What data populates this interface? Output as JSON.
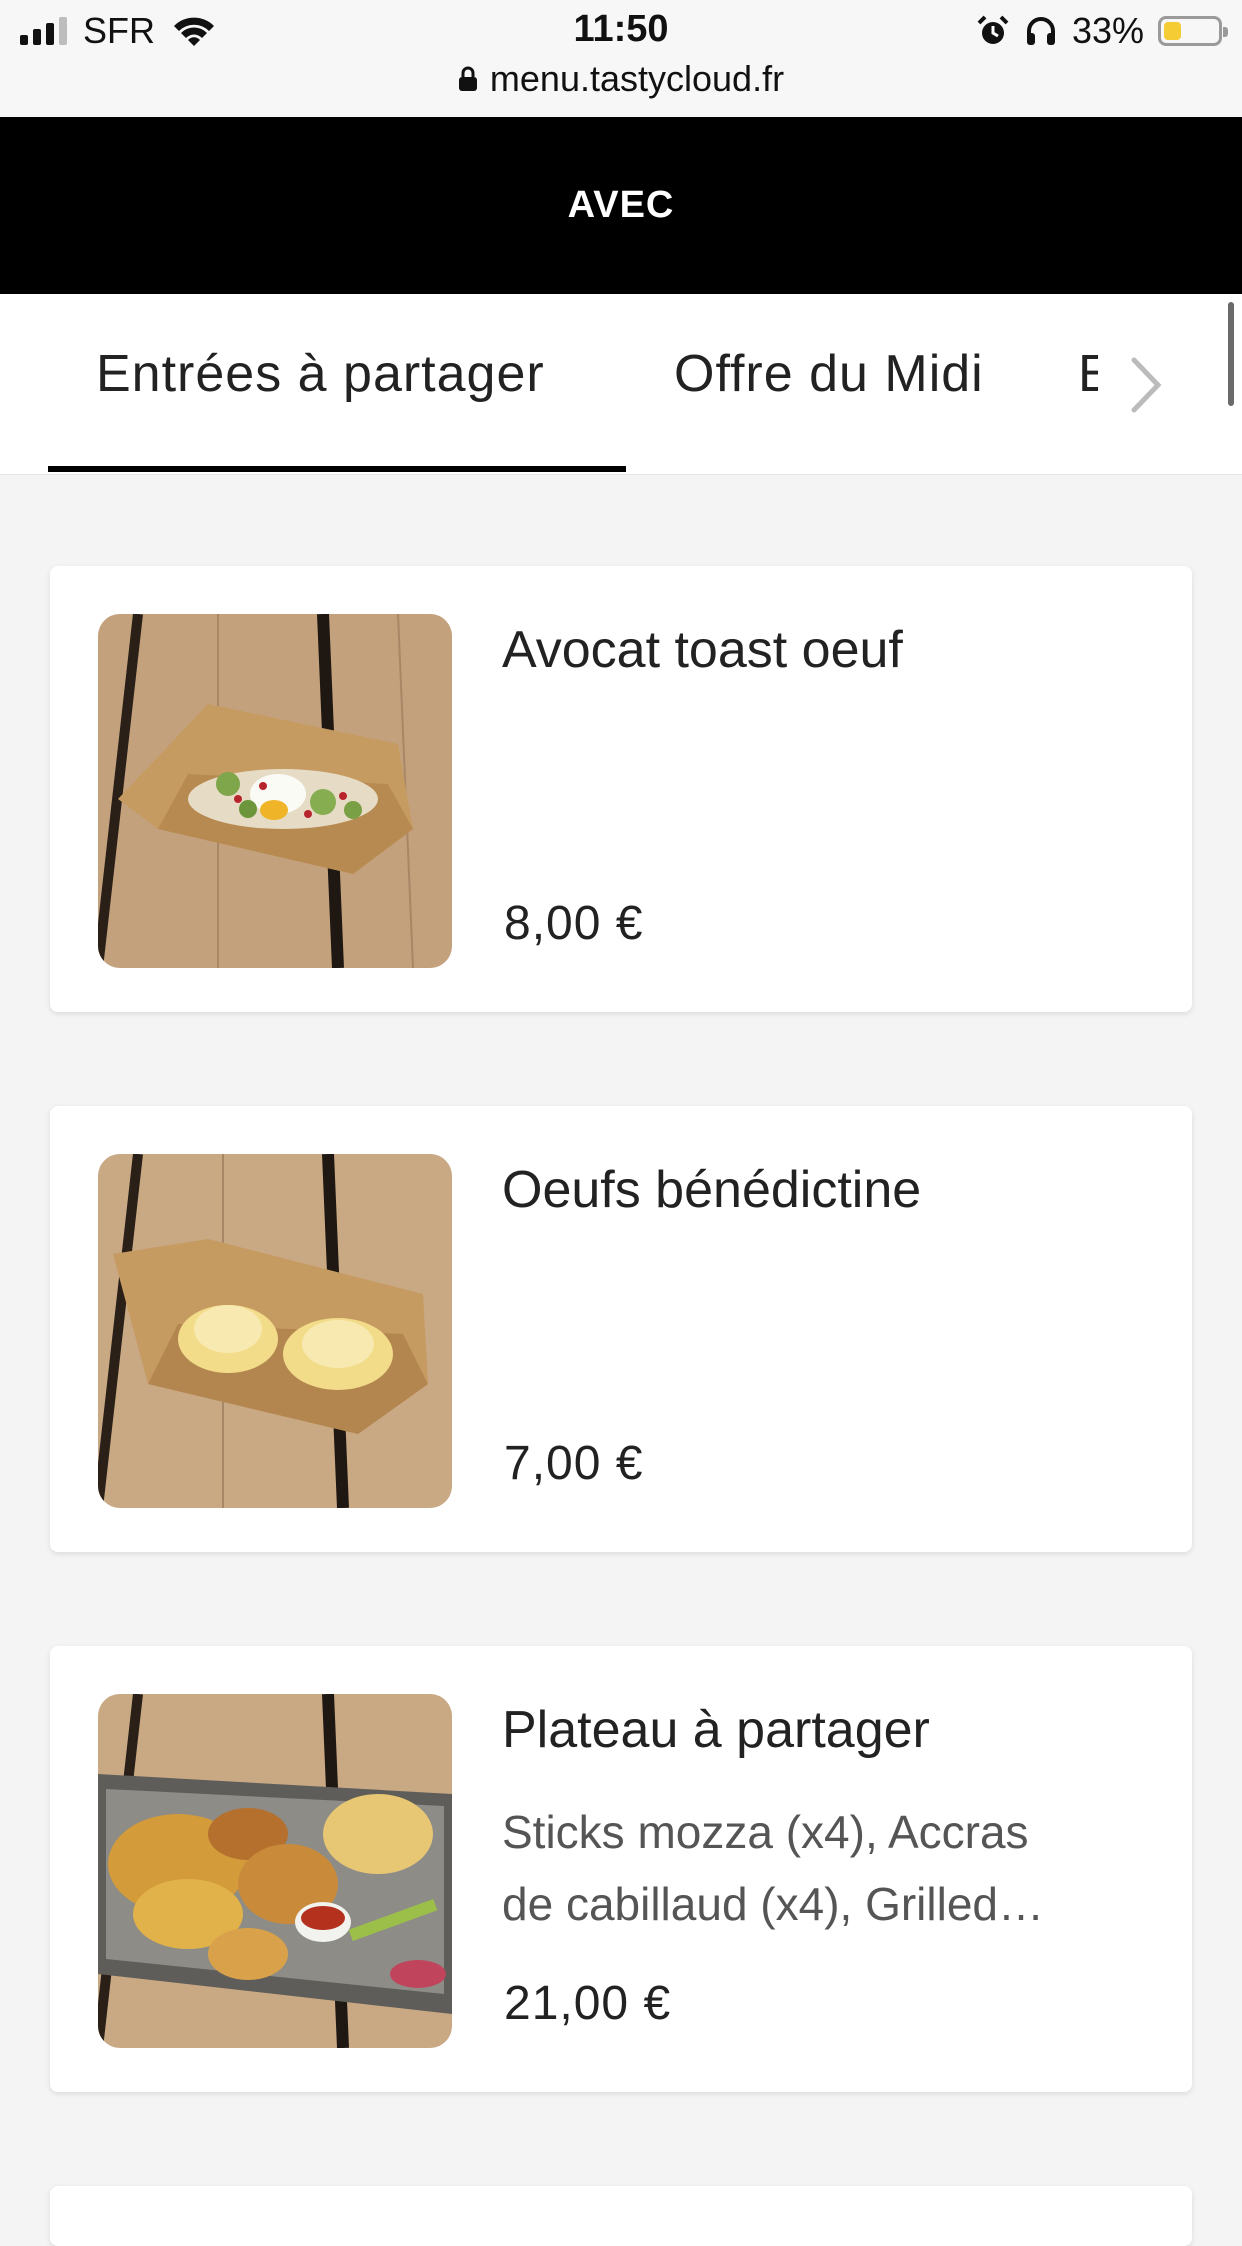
{
  "status_bar": {
    "carrier": "SFR",
    "time": "11:50",
    "battery_percent": "33%",
    "battery_level": 0.33,
    "url": "menu.tastycloud.fr"
  },
  "header": {
    "brand": "AVEC"
  },
  "tabs": [
    {
      "label": "Entrées à partager",
      "active": true
    },
    {
      "label": "Offre du Midi",
      "active": false
    },
    {
      "label": "E",
      "active": false
    }
  ],
  "items": [
    {
      "name": "Avocat toast oeuf",
      "description": [],
      "price": "8,00 €",
      "image": "avocado-toast-egg-photo"
    },
    {
      "name": "Oeufs bénédictine",
      "description": [],
      "price": "7,00 €",
      "image": "eggs-benedict-photo"
    },
    {
      "name": "Plateau à partager",
      "description": [
        "Sticks mozza (x4), Accras",
        "de cabillaud (x4), Grilled…"
      ],
      "price": "21,00 €",
      "image": "sharing-platter-photo"
    }
  ],
  "colors": {
    "header_bg": "#000000",
    "accent_underline": "#000000",
    "page_bg": "#f4f4f4",
    "battery": "#f5cc33"
  }
}
